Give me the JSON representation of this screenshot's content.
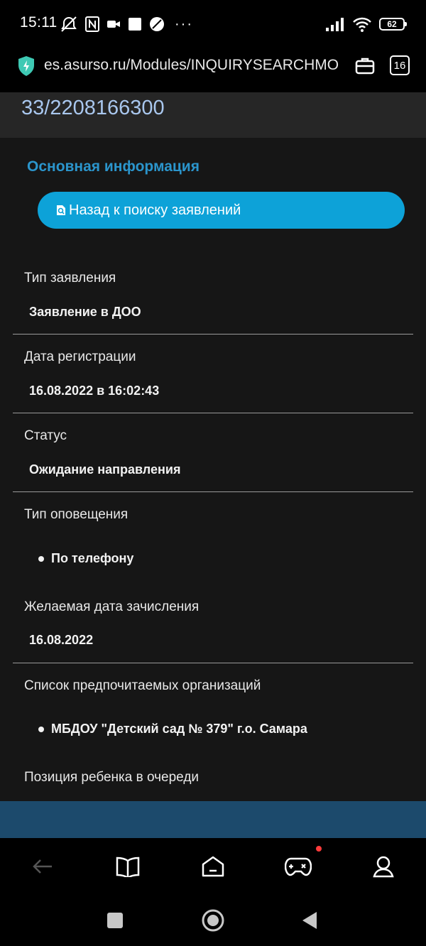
{
  "status_bar": {
    "time": "15:11",
    "battery": "62",
    "more": "···"
  },
  "url_bar": {
    "url": "es.asurso.ru/Modules/INQUIRYSEARCHMO",
    "tab_count": "16"
  },
  "page": {
    "inquiry_number": "33/2208166300",
    "section_title": "Основная информация",
    "back_button_label": "Назад к поиску заявлений",
    "fields": [
      {
        "label": "Тип заявления",
        "value": "Заявление в ДОО"
      },
      {
        "label": "Дата регистрации",
        "value": "16.08.2022 в 16:02:43"
      },
      {
        "label": "Статус",
        "value": "Ожидание направления"
      },
      {
        "label": "Тип оповещения",
        "items": [
          "По телефону"
        ]
      },
      {
        "label": "Желаемая дата зачисления",
        "value": "16.08.2022"
      },
      {
        "label": "Список предпочитаемых организаций",
        "items": [
          "МБДОУ \"Детский сад № 379\" г.о. Самара"
        ]
      },
      {
        "label": "Позиция ребенка в очереди"
      }
    ]
  },
  "colors": {
    "accent": "#0da2d8",
    "section_title": "#2b95cc",
    "link_number": "#a9c7ee",
    "page_bg": "#161616",
    "footer": "#1c4a6c"
  },
  "icons": {
    "status_left": [
      "mute-alarm-icon",
      "nfc-icon",
      "video-call-icon",
      "square-notification-icon",
      "do-not-disturb-icon"
    ],
    "status_right": [
      "signal-icon",
      "wifi-icon",
      "battery-icon"
    ],
    "url_bar": [
      "shield-icon",
      "briefcase-icon",
      "tab-counter-icon"
    ],
    "toolbar": [
      "back-arrow-icon",
      "book-icon",
      "home-icon",
      "gamepad-icon",
      "profile-icon"
    ],
    "nav": [
      "recent-apps-icon",
      "home-circle-icon",
      "back-triangle-icon"
    ]
  }
}
